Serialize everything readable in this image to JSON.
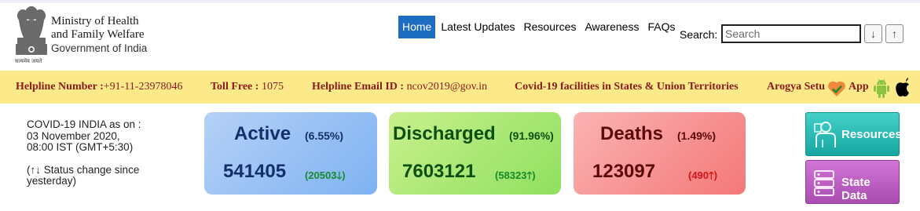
{
  "header": {
    "ministry_line1": "Ministry of Health",
    "ministry_line2": "and Family Welfare",
    "ministry_line3": "Government of India",
    "emblem_motto": "सत्यमेव जयते"
  },
  "nav": {
    "items": [
      {
        "label": "Home",
        "active": true
      },
      {
        "label": "Latest Updates"
      },
      {
        "label": "Resources"
      },
      {
        "label": "Awareness"
      },
      {
        "label": "FAQs"
      }
    ]
  },
  "search": {
    "label": "Search:",
    "placeholder": "Search",
    "sort_down": "↓",
    "sort_up": "↑"
  },
  "helpline": {
    "number_label": "Helpline Number :",
    "number_value": "+91-11-23978046",
    "toll_label": "Toll Free :",
    "toll_value": "1075",
    "email_label": "Helpline Email ID :",
    "email_value": "ncov2019@gov.in",
    "facilities": "Covid-19 facilities in States & Union Territories",
    "arogya": "Arogya Setu",
    "app": "App"
  },
  "info": {
    "line1": "COVID-19 INDIA as on :",
    "line2": "03 November 2020,",
    "line3": "08:00 IST (GMT+5:30)",
    "status_note": "(↑↓ Status change since yesterday)"
  },
  "stats": {
    "active": {
      "title": "Active",
      "percent": "(6.55%)",
      "count": "541405",
      "change": "(20503",
      "direction": "down"
    },
    "discharged": {
      "title": "Discharged",
      "percent": "(91.96%)",
      "count": "7603121",
      "change": "(58323",
      "direction": "up"
    },
    "deaths": {
      "title": "Deaths",
      "percent": "(1.49%)",
      "count": "123097",
      "change": "(490",
      "direction": "up"
    }
  },
  "side_buttons": {
    "resources": "Resources",
    "state_data": "State Data"
  },
  "colors": {
    "nav_active": "#1d6ec0",
    "helpbar_bg": "#fbe98a",
    "helpbar_text": "#8b1a1a",
    "increase_green": "#178a2a",
    "death_red": "#d41414"
  }
}
